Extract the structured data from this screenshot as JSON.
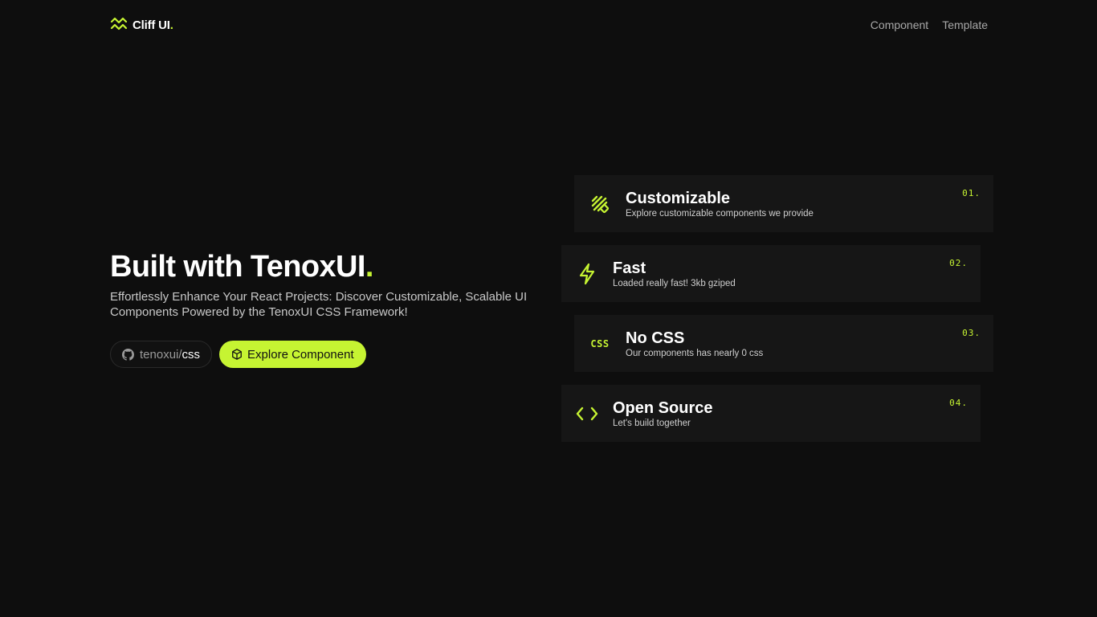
{
  "header": {
    "brand_name": "Cliff UI",
    "brand_dot": ".",
    "nav": [
      {
        "label": "Component"
      },
      {
        "label": "Template"
      }
    ]
  },
  "hero": {
    "title": "Built with TenoxUI",
    "title_dot": ".",
    "description": "Effortlessly Enhance Your React Projects: Discover Customizable, Scalable UI Components Powered by the TenoxUI CSS Framework!",
    "repo": {
      "owner": "tenoxui",
      "slash": "/",
      "name": "css",
      "icon": "github-icon"
    },
    "explore_label": "Explore Component",
    "explore_icon": "cube-icon"
  },
  "features": [
    {
      "title": "Customizable",
      "subtitle": "Explore customizable components we provide",
      "number": "01.",
      "icon": "brush-icon"
    },
    {
      "title": "Fast",
      "subtitle": "Loaded really fast! 3kb gziped",
      "number": "02.",
      "icon": "lightning-icon"
    },
    {
      "title": "No CSS",
      "subtitle": "Our components has nearly 0 css",
      "number": "03.",
      "icon": "css-icon",
      "icon_text": "CSS"
    },
    {
      "title": "Open Source",
      "subtitle": "Let's build together",
      "number": "04.",
      "icon": "code-icon"
    }
  ],
  "colors": {
    "accent": "#c6f432",
    "background": "#0e0e0e",
    "card": "#161616"
  }
}
